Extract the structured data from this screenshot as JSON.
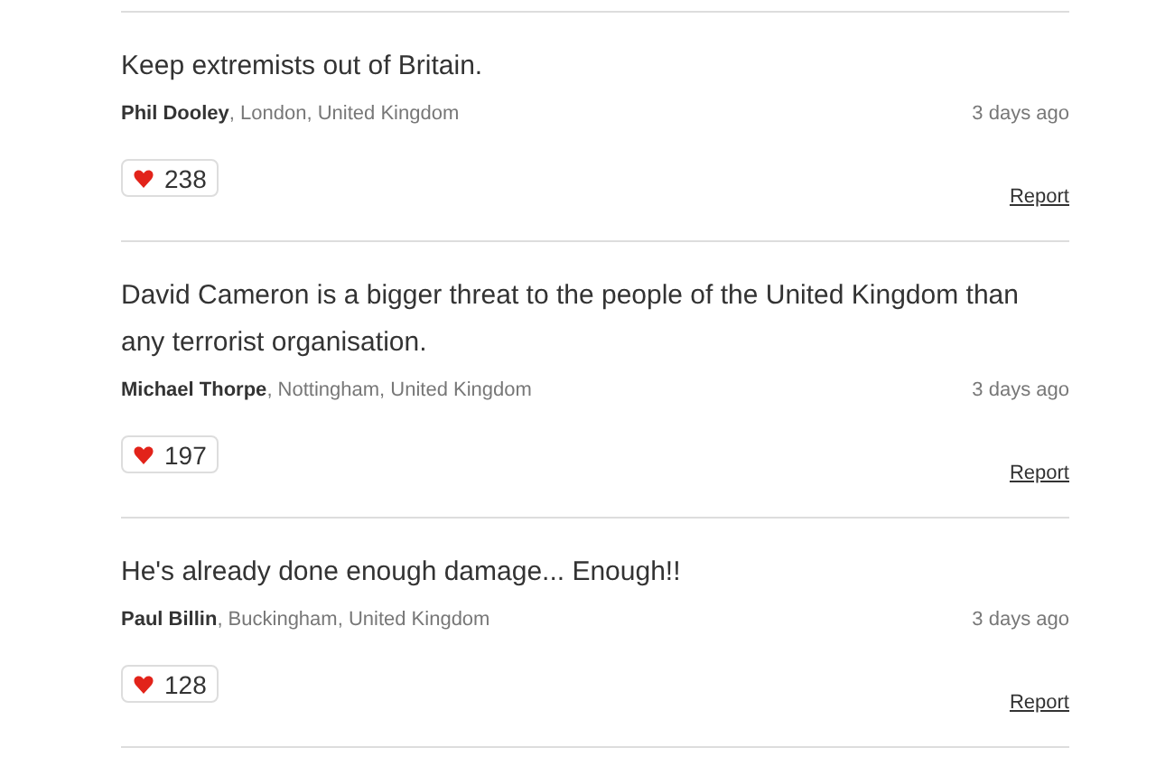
{
  "comments": [
    {
      "text": "Keep extremists out of Britain.",
      "author": "Phil Dooley",
      "location": ", London, United Kingdom",
      "time": "3 days ago",
      "likes": "238",
      "report": "Report"
    },
    {
      "text": "David Cameron is a bigger threat to the people of the United Kingdom than any terrorist organisation.",
      "author": "Michael Thorpe",
      "location": ", Nottingham, United Kingdom",
      "time": "3 days ago",
      "likes": "197",
      "report": "Report"
    },
    {
      "text": "He's already done enough damage... Enough!!",
      "author": "Paul Billin",
      "location": ", Buckingham, United Kingdom",
      "time": "3 days ago",
      "likes": "128",
      "report": "Report"
    }
  ]
}
